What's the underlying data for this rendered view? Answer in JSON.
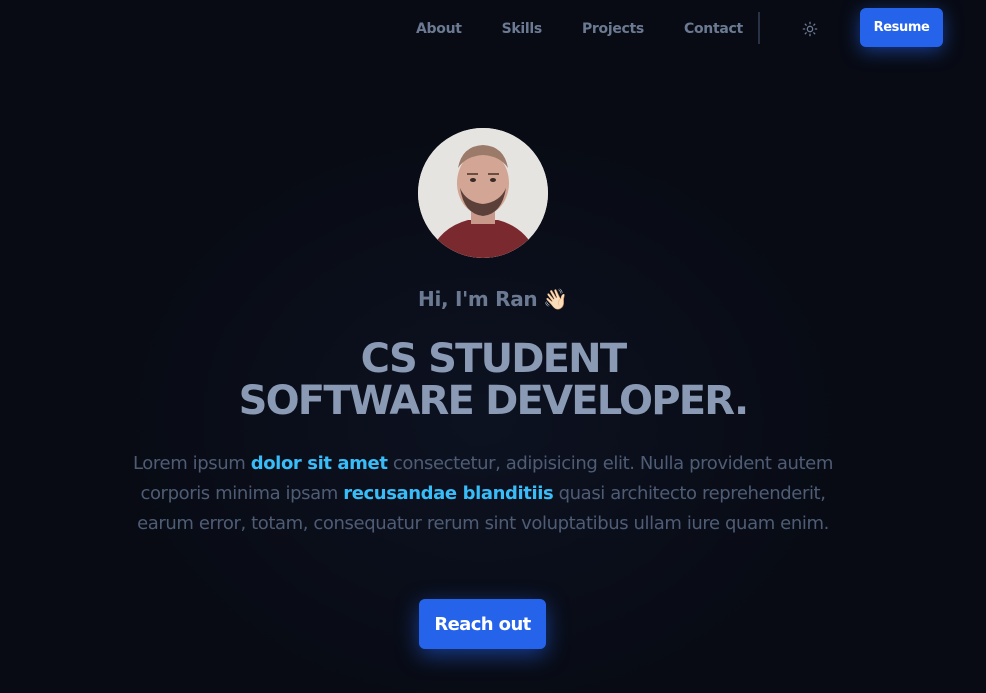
{
  "nav": {
    "links": [
      "About",
      "Skills",
      "Projects",
      "Contact"
    ],
    "theme_icon": "sun-icon",
    "resume_label": "Resume"
  },
  "hero": {
    "avatar_icon": "profile-photo",
    "greeting": "Hi, I'm Ran",
    "wave_emoji": "👋🏻",
    "headline_line1": "CS STUDENT",
    "headline_line2": "SOFTWARE DEVELOPER.",
    "bio": {
      "part1": "Lorem ipsum ",
      "highlight1": "dolor sit amet",
      "part2": " consectetur, adipisicing elit. Nulla provident autem corporis minima ipsam ",
      "highlight2": "recusandae blanditiis",
      "part3": " quasi architecto reprehenderit, earum error, totam, consequatur rerum sint voluptatibus ullam iure quam enim."
    },
    "cta_label": "Reach out"
  },
  "colors": {
    "background": "#080b14",
    "accent": "#2563eb",
    "highlight": "#38bdf8",
    "muted_text": "#6b7a92"
  }
}
